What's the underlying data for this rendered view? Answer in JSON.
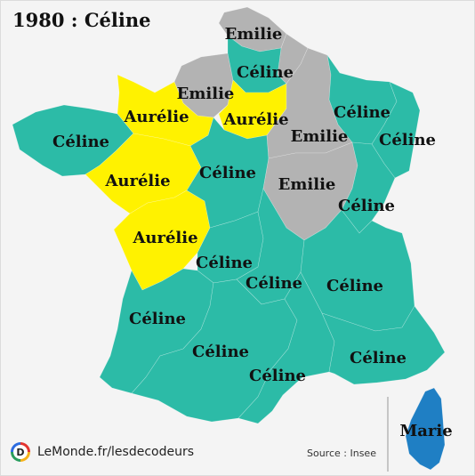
{
  "title": "1980 : Céline",
  "regions": [
    {
      "id": "nord-pas-de-calais",
      "name": "Emilie",
      "color": "#b3b3b3"
    },
    {
      "id": "picardie",
      "name": "Emilie",
      "color": "#b3b3b3"
    },
    {
      "id": "haute-normandie",
      "name": "Emilie",
      "color": "#b3b3b3"
    },
    {
      "id": "ile-de-france",
      "name": "Céline",
      "color": "#2cbba7"
    },
    {
      "id": "ile-de-france-center",
      "name": "Aurélie",
      "color": "#fff200"
    },
    {
      "id": "basse-normandie",
      "name": "Aurélie",
      "color": "#fff200"
    },
    {
      "id": "bretagne",
      "name": "Céline",
      "color": "#2cbba7"
    },
    {
      "id": "pays-de-la-loire",
      "name": "Aurélie",
      "color": "#fff200"
    },
    {
      "id": "poitou-charentes",
      "name": "Aurélie",
      "color": "#fff200"
    },
    {
      "id": "centre",
      "name": "Céline",
      "color": "#2cbba7"
    },
    {
      "id": "champagne-ardenne",
      "name": "Emilie",
      "color": "#b3b3b3"
    },
    {
      "id": "lorraine",
      "name": "Céline",
      "color": "#2cbba7"
    },
    {
      "id": "alsace",
      "name": "Céline",
      "color": "#2cbba7"
    },
    {
      "id": "bourgogne",
      "name": "Emilie",
      "color": "#b3b3b3"
    },
    {
      "id": "franche-comte",
      "name": "Céline",
      "color": "#2cbba7"
    },
    {
      "id": "limousin",
      "name": "Céline",
      "color": "#2cbba7"
    },
    {
      "id": "auvergne",
      "name": "Céline",
      "color": "#2cbba7"
    },
    {
      "id": "rhone-alpes",
      "name": "Céline",
      "color": "#2cbba7"
    },
    {
      "id": "aquitaine",
      "name": "Céline",
      "color": "#2cbba7"
    },
    {
      "id": "midi-pyrenees",
      "name": "Céline",
      "color": "#2cbba7"
    },
    {
      "id": "languedoc-roussillon",
      "name": "Céline",
      "color": "#2cbba7"
    },
    {
      "id": "paca",
      "name": "Céline",
      "color": "#2cbba7"
    },
    {
      "id": "corse",
      "name": "Marie",
      "color": "#1f7fc4"
    }
  ],
  "footer": {
    "logo_letter": "D",
    "brand": "LeMonde.fr/lesdecodeurs",
    "source": "Source : Insee"
  }
}
